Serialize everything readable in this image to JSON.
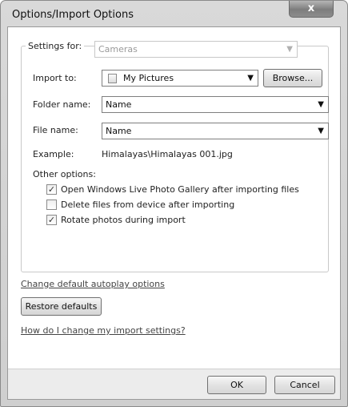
{
  "window": {
    "title": "Options/Import Options",
    "close_label": "x"
  },
  "settings_for": {
    "label": "Settings for:",
    "value": "Cameras"
  },
  "import_to": {
    "label": "Import to:",
    "value": "My Pictures",
    "browse_label": "Browse..."
  },
  "folder_name": {
    "label": "Folder name:",
    "value": "Name"
  },
  "file_name": {
    "label": "File name:",
    "value": "Name"
  },
  "example": {
    "label": "Example:",
    "value": "Himalayas\\Himalayas 001.jpg"
  },
  "other_options": {
    "label": "Other options:",
    "items": [
      {
        "label": "Open Windows Live Photo Gallery after importing files",
        "checked": true
      },
      {
        "label": "Delete files from device after importing",
        "checked": false
      },
      {
        "label": "Rotate photos during import",
        "checked": true
      }
    ]
  },
  "links": {
    "autoplay": "Change default autoplay options",
    "help": "How do I change my import settings?"
  },
  "restore_defaults_label": "Restore defaults",
  "footer": {
    "ok_label": "OK",
    "cancel_label": "Cancel"
  }
}
